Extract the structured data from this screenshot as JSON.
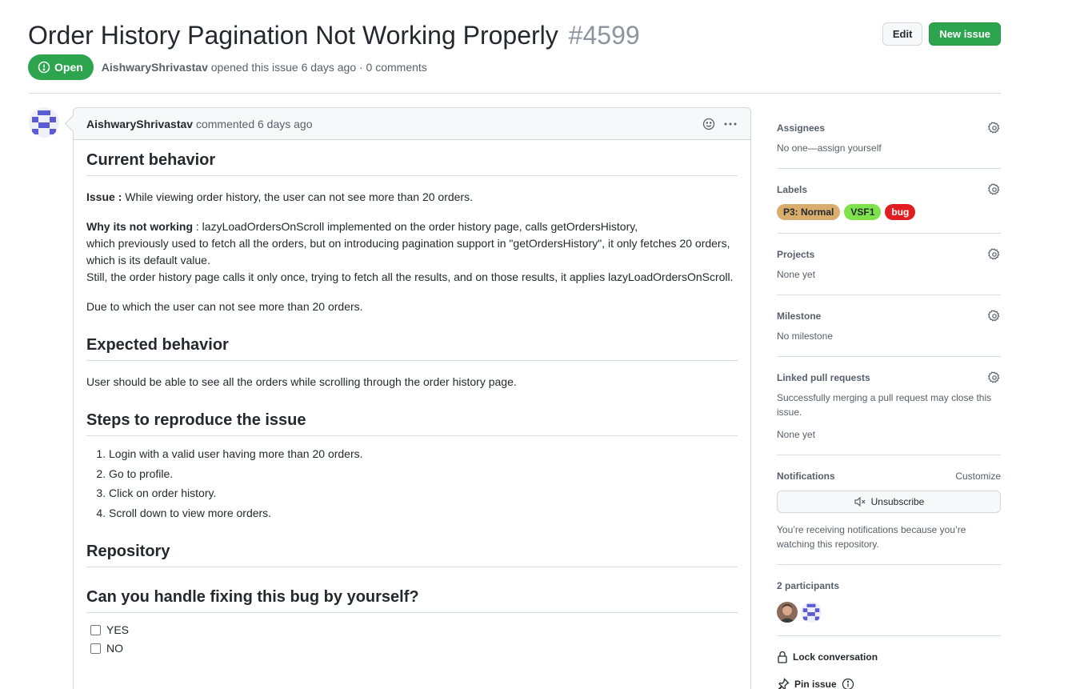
{
  "issue": {
    "title": "Order History Pagination Not Working Properly",
    "number": "#4599",
    "state": "Open",
    "author": "AishwaryShrivastav",
    "meta": "opened this issue 6 days ago · 0 comments"
  },
  "actions": {
    "edit": "Edit",
    "new_issue": "New issue"
  },
  "comment": {
    "author": "AishwaryShrivastav",
    "time": "commented 6 days ago",
    "sections": {
      "current_behavior": "Current behavior",
      "issue_label": "Issue :",
      "issue_text": " While viewing order history, the user can not see more than 20 orders.",
      "why_label": "Why its not working",
      "why_line1": " : lazyLoadOrdersOnScroll implemented on the order history page, calls getOrdersHistory,",
      "why_line2": "which previously used to fetch all the orders, but on introducing pagination support in \"getOrdersHistory\", it only fetches 20 orders, which is its default value.",
      "why_line3": "Still, the order history page calls it only once, trying to fetch all the results, and on those results, it applies lazyLoadOrdersOnScroll.",
      "due_text": "Due to which the user can not see more than 20 orders.",
      "expected_behavior": "Expected behavior",
      "expected_text": "User should be able to see all the orders while scrolling through the order history page.",
      "steps_title": "Steps to reproduce the issue",
      "steps": [
        "Login with a valid user having more than 20 orders.",
        "Go to profile.",
        "Click on order history.",
        "Scroll down to view more orders."
      ],
      "repository": "Repository",
      "handle_title": "Can you handle fixing this bug by yourself?",
      "options": [
        "YES",
        "NO"
      ]
    }
  },
  "sidebar": {
    "assignees": {
      "title": "Assignees",
      "value": "No one—assign yourself"
    },
    "labels": {
      "title": "Labels",
      "items": [
        {
          "name": "P3: Normal",
          "bg": "#d9ad6c",
          "fg": "#24292f"
        },
        {
          "name": "VSF1",
          "bg": "#7ee24a",
          "fg": "#24292f"
        },
        {
          "name": "bug",
          "bg": "#e11d21",
          "fg": "#ffffff"
        }
      ]
    },
    "projects": {
      "title": "Projects",
      "value": "None yet"
    },
    "milestone": {
      "title": "Milestone",
      "value": "No milestone"
    },
    "linked_prs": {
      "title": "Linked pull requests",
      "desc": "Successfully merging a pull request may close this issue.",
      "value": "None yet"
    },
    "notifications": {
      "title": "Notifications",
      "customize": "Customize",
      "unsubscribe": "Unsubscribe",
      "reason": "You’re receiving notifications because you’re watching this repository."
    },
    "participants": {
      "title": "2 participants"
    },
    "lock": "Lock conversation",
    "pin": "Pin issue"
  },
  "colors": {
    "open_green": "#2da44e",
    "muted": "#57606a",
    "border": "#d0d7de"
  }
}
